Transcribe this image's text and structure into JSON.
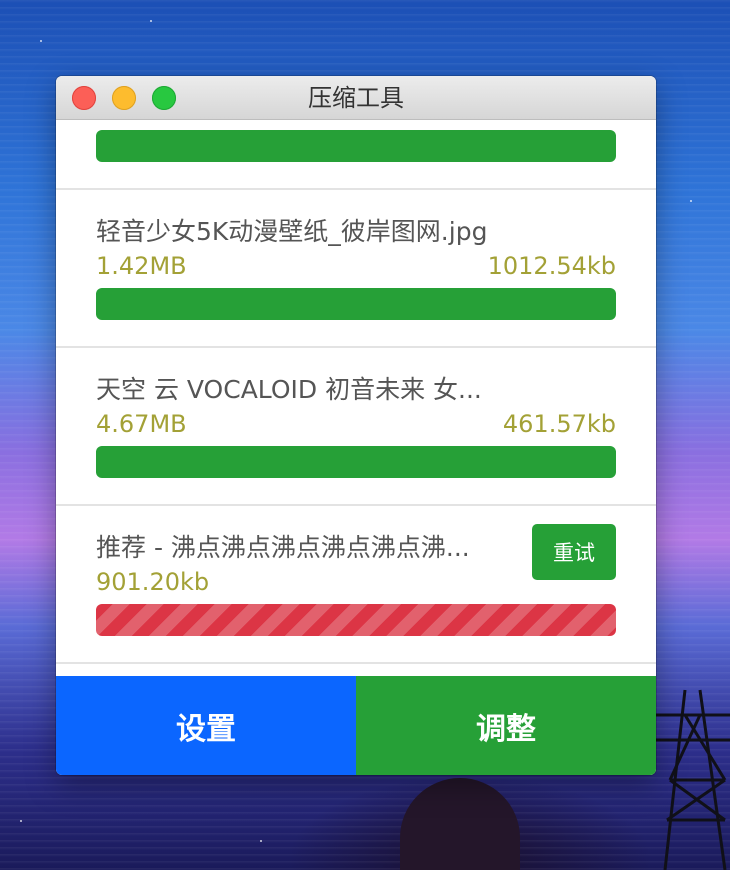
{
  "window": {
    "title": "压缩工具"
  },
  "items": [
    {
      "name": "",
      "original_size": "",
      "compressed_size": "",
      "status": "done",
      "progress": 1.0
    },
    {
      "name": "轻音少女5K动漫壁纸_彼岸图网.jpg",
      "original_size": "1.42MB",
      "compressed_size": "1012.54kb",
      "status": "done",
      "progress": 1.0
    },
    {
      "name": "天空 云 VOCALOID 初音未来 女...",
      "original_size": "4.67MB",
      "compressed_size": "461.57kb",
      "status": "done",
      "progress": 1.0
    },
    {
      "name": "推荐 - 沸点沸点沸点沸点沸点沸...",
      "original_size": "901.20kb",
      "compressed_size": "",
      "status": "failed",
      "progress": 1.0,
      "retry_label": "重试"
    }
  ],
  "footer": {
    "settings_label": "设置",
    "adjust_label": "调整"
  },
  "colors": {
    "success": "#26a037",
    "failed": "#dc3545",
    "primary": "#0b66ff",
    "size_text": "#a3a136"
  }
}
